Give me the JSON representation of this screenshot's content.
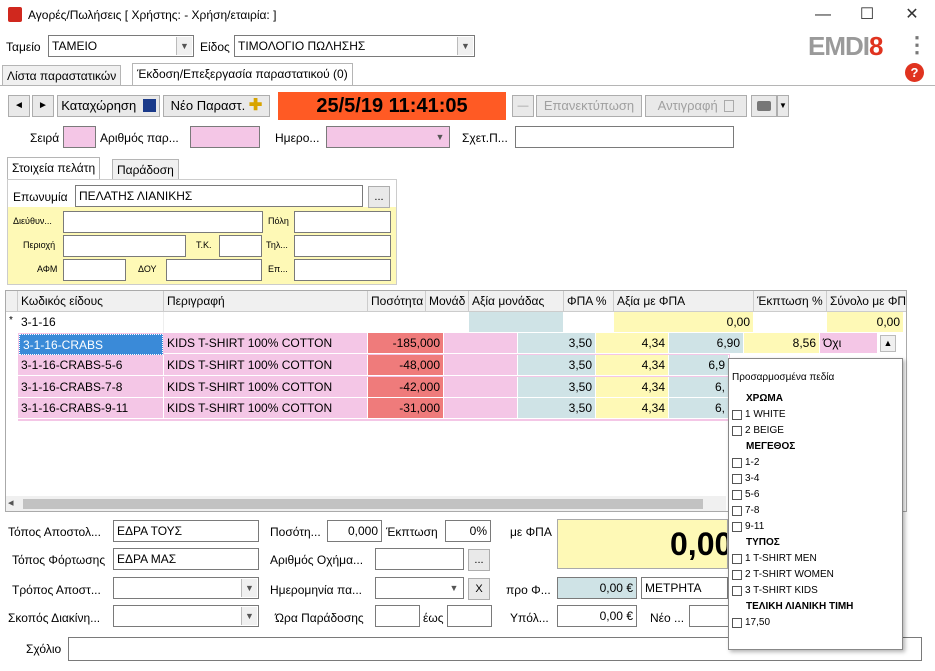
{
  "window": {
    "title": "Αγορές/Πωλήσεις  [ Χρήστης: - Χρήση/εταιρία: ]",
    "minimize": "—",
    "maximize": "☐",
    "close": "✕"
  },
  "header": {
    "tameio_label": "Ταμείο",
    "tameio_value": "ΤΑΜΕΙΟ",
    "eidos_label": "Είδος",
    "eidos_value": "ΤΙΜΟΛΟΓΙΟ ΠΩΛΗΣΗΣ",
    "logo_text": "EMDI",
    "logo_num": "8",
    "menu_glyph": "⋮",
    "help_glyph": "?"
  },
  "tabs": {
    "list": "Λίστα παραστατικών",
    "edit": "Έκδοση/Επεξεργασία παραστατικού (0)"
  },
  "toolbar": {
    "prev": "◄",
    "next": "►",
    "register": "Καταχώρηση",
    "new_doc": "Νέο Παραστ.",
    "datetime": "25/5/19 11:41:05",
    "minus": "—",
    "reprint": "Επανεκτύπωση",
    "copy": "Αντιγραφή"
  },
  "docinfo": {
    "seira_label": "Σειρά",
    "arithmos_label": "Αριθμός παρ...",
    "hmero_label": "Ημερο...",
    "sxet_label": "Σχετ.Π..."
  },
  "customer_tabs": {
    "customer": "Στοιχεία πελάτη",
    "delivery": "Παράδοση"
  },
  "customer": {
    "eponymia_label": "Επωνυμία",
    "eponymia_value": "ΠΕΛΑΤΗΣ ΛΙΑΝΙΚΗΣ",
    "browse": "...",
    "address_label": "Διεύθυν...",
    "city_label": "Πόλη",
    "area_label": "Περιοχή",
    "tk_label": "Τ.Κ.",
    "phone_label": "Τηλ...",
    "afm_label": "ΑΦΜ",
    "doy_label": "ΔΟΥ",
    "ep_label": "Επ..."
  },
  "grid": {
    "headers": [
      "Κωδικός είδους",
      "Περιγραφή",
      "Ποσότητα",
      "Μονάδ",
      "Αξία μονάδας",
      "ΦΠΑ %",
      "Αξία με ΦΠΑ",
      "Έκπτωση %",
      "Σύνολο με ΦΠΑ"
    ],
    "new_row_marker": "*",
    "new_row": {
      "code": "3-1-16",
      "value_vat": "0,00",
      "total": "0,00"
    },
    "rows": [
      {
        "code": "3-1-16-CRABS",
        "desc": "KIDS T-SHIRT 100% COTTON",
        "qty": "-185,000",
        "vat": "3,50",
        "unit_value": "4,34",
        "value_vat": "6,90",
        "discount": "8,56",
        "total": "Όχι"
      },
      {
        "code": "3-1-16-CRABS-5-6",
        "desc": "KIDS T-SHIRT 100% COTTON",
        "qty": "-48,000",
        "vat": "3,50",
        "unit_value": "4,34",
        "value_vat": "6,9"
      },
      {
        "code": "3-1-16-CRABS-7-8",
        "desc": "KIDS T-SHIRT 100% COTTON",
        "qty": "-42,000",
        "vat": "3,50",
        "unit_value": "4,34",
        "value_vat": "6,"
      },
      {
        "code": "3-1-16-CRABS-9-11",
        "desc": "KIDS T-SHIRT 100% COTTON",
        "qty": "-31,000",
        "vat": "3,50",
        "unit_value": "4,34",
        "value_vat": "6,"
      }
    ]
  },
  "popup": {
    "title": "Προσαρμοσμένα πεδία",
    "groups": [
      {
        "name": "ΧΡΩΜΑ",
        "items": [
          "1 WHITE",
          "2 BEIGE"
        ]
      },
      {
        "name": "ΜΕΓΕΘΟΣ",
        "items": [
          "1-2",
          "3-4",
          "5-6",
          "7-8",
          "9-11"
        ]
      },
      {
        "name": "ΤΥΠΟΣ",
        "items": [
          "1 T-SHIRT MEN",
          "2 T-SHIRT WOMEN",
          "3 T-SHIRT KIDS"
        ]
      },
      {
        "name": "ΤΕΛΙΚΗ ΛΙΑΝΙΚΗ ΤΙΜΗ",
        "items": [
          "17,50"
        ]
      }
    ]
  },
  "footer": {
    "topos_apostolis_label": "Τόπος Αποστολ...",
    "topos_apostolis_value": "ΕΔΡΑ ΤΟΥΣ",
    "topos_fortosis_label": "Τόπος Φόρτωσης",
    "topos_fortosis_value": "ΕΔΡΑ ΜΑΣ",
    "tropos_label": "Τρόπος Αποστ...",
    "skopos_label": "Σκοπός Διακίνη...",
    "posotita_label": "Ποσότη...",
    "posotita_value": "0,000",
    "ekptosi_label": "Έκπτωση",
    "ekptosi_value": "0%",
    "oxima_label": "Αριθμός Οχήμα...",
    "imerominia_label": "Ημερομηνία πα...",
    "clear": "X",
    "ora_label": "Ώρα Παράδοσης",
    "eos_label": "έως",
    "me_fpa_label": "με ΦΠΑ",
    "big_total": "0,00",
    "pro_label": "προ Φ...",
    "pro_value": "0,00 €",
    "payment": "ΜΕΤΡΗΤΑ",
    "ypol_label": "Υπόλ...",
    "ypol_value": "0,00 €",
    "neo_label": "Νέο ...",
    "sxolio_label": "Σχόλιο"
  }
}
